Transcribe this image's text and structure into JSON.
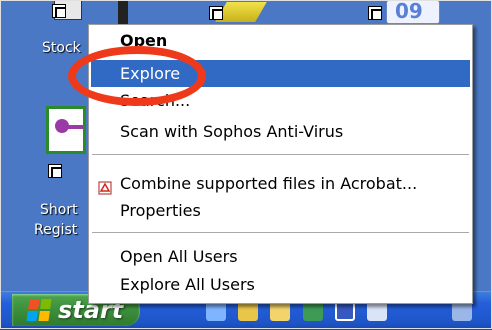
{
  "desktop": {
    "icons": [
      {
        "label": "Stock"
      },
      {
        "label_line1": "Short",
        "label_line2": "Regist"
      },
      {
        "badge": "09"
      }
    ]
  },
  "context_menu": {
    "items": [
      {
        "label": "Open",
        "bold": true
      },
      {
        "label": "Explore",
        "selected": true
      },
      {
        "label": "Search..."
      },
      {
        "label": "Scan with Sophos Anti-Virus"
      },
      {
        "label": "Combine supported files in Acrobat...",
        "icon": "acrobat-icon"
      },
      {
        "label": "Properties"
      },
      {
        "label": "Open All Users"
      },
      {
        "label": "Explore All Users"
      }
    ]
  },
  "taskbar": {
    "start_label": "start"
  },
  "colors": {
    "selection": "#316ac5",
    "annotation_circle": "#ee3a1a",
    "taskbar": "#245edb",
    "start_button": "#3c8f3c"
  }
}
